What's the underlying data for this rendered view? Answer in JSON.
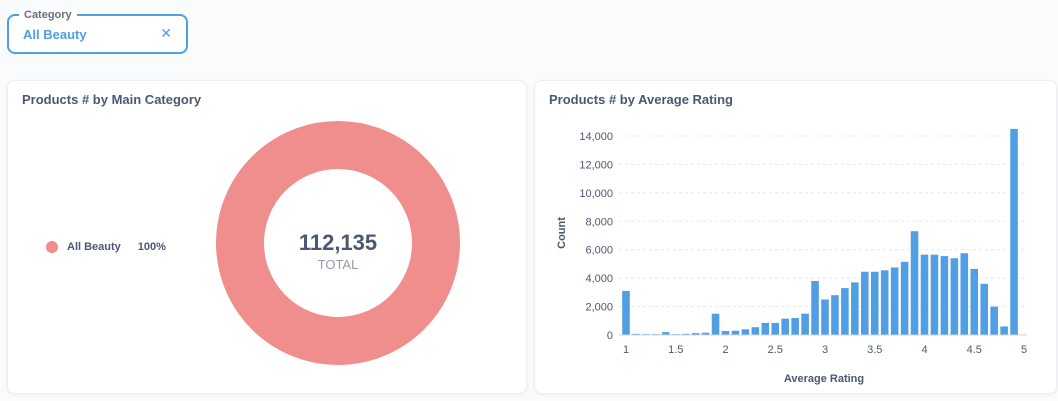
{
  "filter": {
    "label": "Category",
    "value": "All Beauty",
    "close_icon": "close-icon"
  },
  "colors": {
    "accent": "#509ee3",
    "donut": "#f08d8d",
    "bar": "#509ee3"
  },
  "donut_card": {
    "title": "Products # by Main Category",
    "total": "112,135",
    "total_label": "TOTAL",
    "legend": [
      {
        "label": "All Beauty",
        "pct": "100%"
      }
    ]
  },
  "bar_card": {
    "title": "Products # by Average Rating"
  },
  "chart_data": [
    {
      "type": "pie",
      "title": "Products # by Main Category",
      "categories": [
        "All Beauty"
      ],
      "values": [
        112135
      ],
      "percentages": [
        "100%"
      ],
      "total": "112,135",
      "total_label": "TOTAL"
    },
    {
      "type": "bar",
      "title": "Products # by Average Rating",
      "xlabel": "Average Rating",
      "ylabel": "Count",
      "xlim": [
        1,
        5
      ],
      "ylim": [
        0,
        14000
      ],
      "x_ticks": [
        "1",
        "1.5",
        "2",
        "2.5",
        "3",
        "3.5",
        "4",
        "4.5",
        "5"
      ],
      "y_ticks": [
        "0",
        "2,000",
        "4,000",
        "6,000",
        "8,000",
        "10,000",
        "12,000",
        "14,000"
      ],
      "grid": true,
      "x": [
        1.0,
        1.1,
        1.2,
        1.3,
        1.4,
        1.5,
        1.6,
        1.7,
        1.8,
        1.9,
        2.0,
        2.1,
        2.2,
        2.3,
        2.4,
        2.5,
        2.6,
        2.7,
        2.8,
        2.9,
        3.0,
        3.1,
        3.2,
        3.3,
        3.4,
        3.5,
        3.6,
        3.7,
        3.8,
        3.9,
        4.0,
        4.1,
        4.2,
        4.3,
        4.4,
        4.5,
        4.6,
        4.7,
        4.8,
        4.9,
        5.0
      ],
      "values": [
        3100,
        80,
        60,
        60,
        200,
        60,
        80,
        130,
        160,
        1500,
        280,
        300,
        400,
        550,
        850,
        850,
        1150,
        1200,
        1500,
        3800,
        2500,
        2800,
        3300,
        3700,
        4450,
        4450,
        4550,
        4750,
        5150,
        7300,
        5650,
        5650,
        5550,
        5400,
        5750,
        4650,
        3600,
        2000,
        600,
        14500,
        0
      ]
    }
  ]
}
